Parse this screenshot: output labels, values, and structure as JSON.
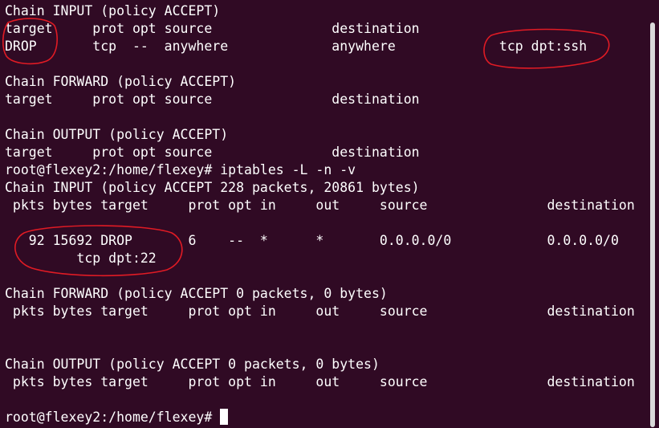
{
  "terminal": {
    "lines": [
      "Chain INPUT (policy ACCEPT)",
      "target     prot opt source               destination",
      "DROP       tcp  --  anywhere             anywhere             tcp dpt:ssh",
      "",
      "Chain FORWARD (policy ACCEPT)",
      "target     prot opt source               destination",
      "",
      "Chain OUTPUT (policy ACCEPT)",
      "target     prot opt source               destination",
      "root@flexey2:/home/flexey# iptables -L -n -v",
      "Chain INPUT (policy ACCEPT 228 packets, 20861 bytes)",
      " pkts bytes target     prot opt in     out     source               destination",
      "",
      "   92 15692 DROP       6    --  *      *       0.0.0.0/0            0.0.0.0/0",
      "         tcp dpt:22",
      "",
      "Chain FORWARD (policy ACCEPT 0 packets, 0 bytes)",
      " pkts bytes target     prot opt in     out     source               destination",
      "",
      "",
      "Chain OUTPUT (policy ACCEPT 0 packets, 0 bytes)",
      " pkts bytes target     prot opt in     out     source               destination",
      ""
    ],
    "prompt": "root@flexey2:/home/flexey# "
  },
  "colors": {
    "background": "#300a24",
    "text": "#ffffff",
    "annotation": "#e01b24"
  }
}
